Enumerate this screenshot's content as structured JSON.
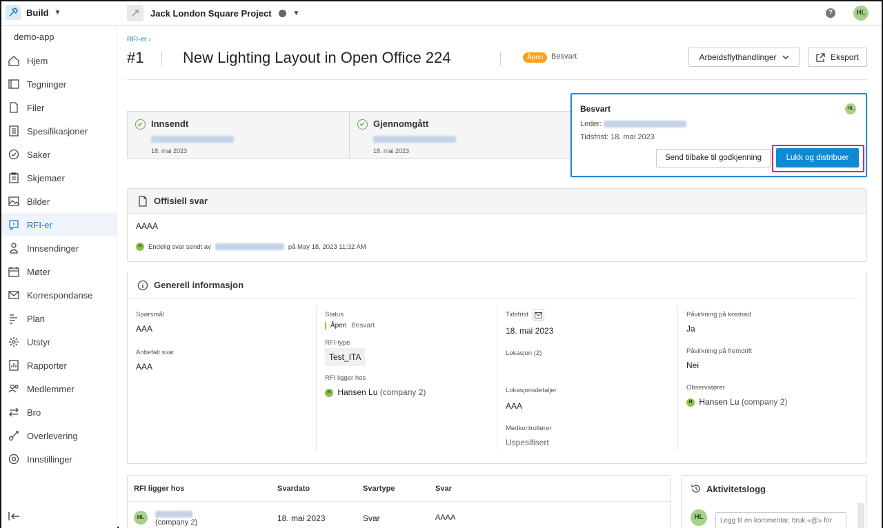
{
  "topbar": {
    "app_name": "Build",
    "project_name": "Jack London Square Project",
    "help": "?",
    "user_initials": "HL"
  },
  "sidebar": {
    "app_label": "demo-app",
    "items": [
      {
        "label": "Hjem",
        "icon": "home-icon"
      },
      {
        "label": "Tegninger",
        "icon": "drawing-icon"
      },
      {
        "label": "Filer",
        "icon": "file-icon"
      },
      {
        "label": "Spesifikasjoner",
        "icon": "spec-icon"
      },
      {
        "label": "Saker",
        "icon": "issue-icon"
      },
      {
        "label": "Skjemaer",
        "icon": "form-icon"
      },
      {
        "label": "Bilder",
        "icon": "photo-icon"
      },
      {
        "label": "RFI-er",
        "icon": "rfi-icon"
      },
      {
        "label": "Innsendinger",
        "icon": "submittal-icon"
      },
      {
        "label": "Møter",
        "icon": "meeting-icon"
      },
      {
        "label": "Korrespondanse",
        "icon": "mail-icon"
      },
      {
        "label": "Plan",
        "icon": "schedule-icon"
      },
      {
        "label": "Utstyr",
        "icon": "asset-icon"
      },
      {
        "label": "Rapporter",
        "icon": "report-icon"
      },
      {
        "label": "Medlemmer",
        "icon": "members-icon"
      },
      {
        "label": "Bro",
        "icon": "bridge-icon"
      },
      {
        "label": "Overlevering",
        "icon": "handover-icon"
      },
      {
        "label": "Innstillinger",
        "icon": "settings-icon"
      }
    ],
    "active_index": 7
  },
  "header": {
    "breadcrumb": "RFI-er",
    "number": "#1",
    "title": "New Lighting Layout in Open Office 224",
    "status_badge": "Åpen",
    "status_sub": "Besvart",
    "workflow_button": "Arbeidsflythandlinger",
    "export_button": "Eksport"
  },
  "steps": [
    {
      "title": "Innsendt",
      "date": "18. mai 2023"
    },
    {
      "title": "Gjennomgått",
      "date": "18. mai 2023"
    }
  ],
  "answer_card": {
    "title": "Besvart",
    "avatar": "HL",
    "lead_label": "Leder:",
    "due": "Tidsfrist: 18. mai 2023",
    "send_back_button": "Send tilbake til godkjenning",
    "close_button": "Lukk og distribuer"
  },
  "official": {
    "title": "Offisiell svar",
    "answer": "AAAA",
    "avatar": "H",
    "footer_prefix": "Endelig svar sendt av",
    "footer_suffix": "på May 18, 2023 11:32 AM"
  },
  "general": {
    "title": "Generell informasjon",
    "question_label": "Spørsmål",
    "question_value": "AAA",
    "suggested_label": "Anbefalt svar",
    "suggested_value": "AAA",
    "status_label": "Status",
    "status_value": "Åpen",
    "status_sub": "Besvart",
    "type_label": "RFI-type",
    "type_value": "Test_ITA",
    "held_label": "RFI ligger hos",
    "held_name": "Hansen Lu",
    "held_company": "(company 2)",
    "due_label": "Tidsfrist",
    "due_value": "18. mai 2023",
    "location_label": "Lokasjon (2)",
    "location_detail_label": "Lokasjonsdetaljer",
    "location_detail_value": "AAA",
    "cocheck_label": "Medkontrollører",
    "cocheck_value": "Uspesifisert",
    "cost_label": "Påvirkning på kostnad",
    "cost_value": "Ja",
    "schedule_label": "Påvirkning på fremdrift",
    "schedule_value": "Nei",
    "watchers_label": "Observatører",
    "watchers_name": "Hansen Lu",
    "watchers_company": "(company 2)",
    "avatar": "H"
  },
  "table": {
    "headers": [
      "RFI ligger hos",
      "Svardato",
      "Svartype",
      "Svar"
    ],
    "row": {
      "avatar": "HL",
      "company": "(company 2)",
      "date": "18. mai 2023",
      "type": "Svar",
      "answer": "AAAA"
    }
  },
  "activity": {
    "title": "Aktivitetslogg",
    "avatar": "HL",
    "placeholder": "Legg til en kommentar, bruk «@» for"
  },
  "colors": {
    "accent": "#0d8ad4",
    "highlight_frame": "#c8288c",
    "badge_open": "#f7a21a",
    "avatar_green": "#a8d08d"
  }
}
